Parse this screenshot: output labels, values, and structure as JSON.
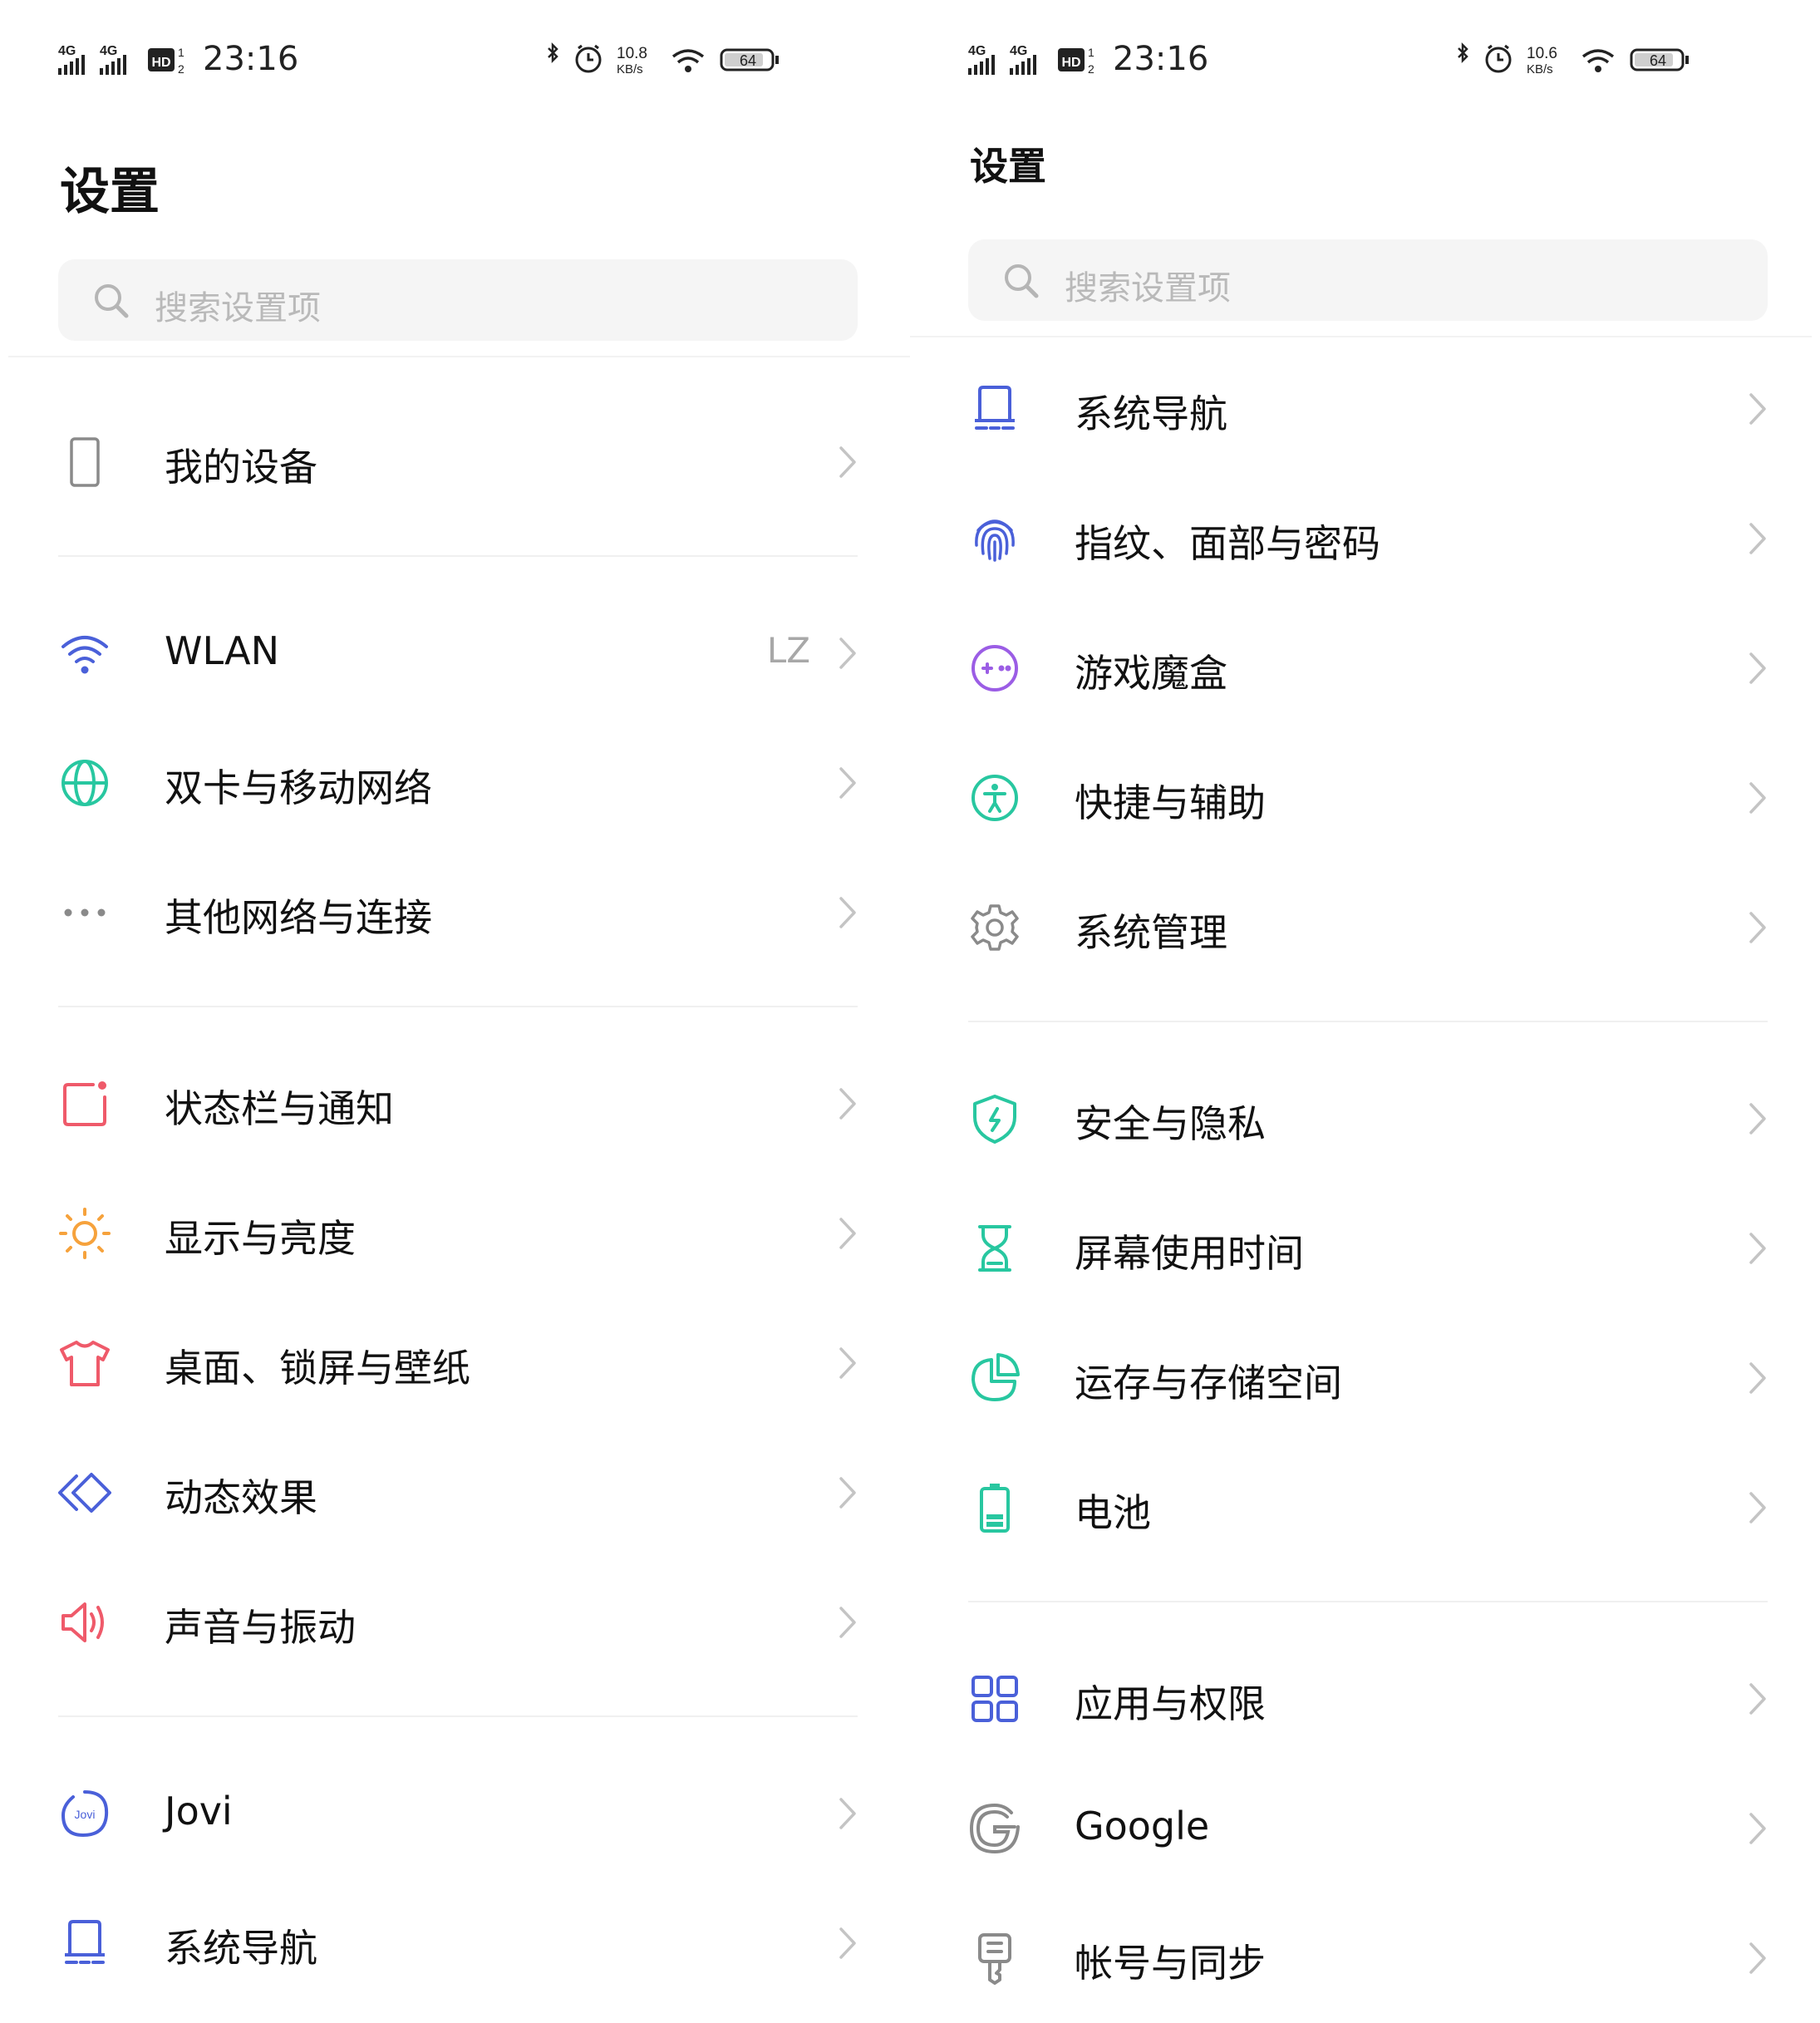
{
  "status_bar": {
    "time": "23:16",
    "left_speed": "10.8",
    "right_speed": "10.6",
    "speed_unit": "KB/s",
    "battery": "64",
    "sig1": "4G",
    "sig2": "4G",
    "hd": "HD"
  },
  "left": {
    "title": "设置",
    "search_placeholder": "搜索设置项",
    "items": [
      {
        "label": "我的设备",
        "value": "",
        "icon": "phone-device-icon"
      },
      {
        "label": "WLAN",
        "value": "LZ",
        "icon": "wifi-icon"
      },
      {
        "label": "双卡与移动网络",
        "value": "",
        "icon": "globe-icon"
      },
      {
        "label": "其他网络与连接",
        "value": "",
        "icon": "more-dots-icon"
      },
      {
        "label": "状态栏与通知",
        "value": "",
        "icon": "notification-icon"
      },
      {
        "label": "显示与亮度",
        "value": "",
        "icon": "sun-icon"
      },
      {
        "label": "桌面、锁屏与壁纸",
        "value": "",
        "icon": "tshirt-icon"
      },
      {
        "label": "动态效果",
        "value": "",
        "icon": "diamond-icon"
      },
      {
        "label": "声音与振动",
        "value": "",
        "icon": "speaker-icon"
      },
      {
        "label": "Jovi",
        "value": "",
        "icon": "jovi-icon",
        "icon_text": "Jovi"
      },
      {
        "label": "系统导航",
        "value": "",
        "icon": "navigation-icon"
      }
    ]
  },
  "right": {
    "title": "设置",
    "search_placeholder": "搜索设置项",
    "items": [
      {
        "label": "系统导航",
        "icon": "navigation-icon"
      },
      {
        "label": "指纹、面部与密码",
        "icon": "fingerprint-icon"
      },
      {
        "label": "游戏魔盒",
        "icon": "game-box-icon"
      },
      {
        "label": "快捷与辅助",
        "icon": "accessibility-icon"
      },
      {
        "label": "系统管理",
        "icon": "gear-icon"
      },
      {
        "label": "安全与隐私",
        "icon": "shield-icon"
      },
      {
        "label": "屏幕使用时间",
        "icon": "hourglass-icon"
      },
      {
        "label": "运存与存储空间",
        "icon": "pie-chart-icon"
      },
      {
        "label": "电池",
        "icon": "battery-icon"
      },
      {
        "label": "应用与权限",
        "icon": "apps-grid-icon"
      },
      {
        "label": "Google",
        "icon": "google-icon"
      },
      {
        "label": "帐号与同步",
        "icon": "account-key-icon"
      }
    ]
  },
  "colors": {
    "blue": "#4a60d9",
    "teal": "#28c7a0",
    "red": "#ef5a6a",
    "orange": "#f6a23c",
    "purple": "#9b5de5",
    "gray": "#8a8a8a"
  }
}
